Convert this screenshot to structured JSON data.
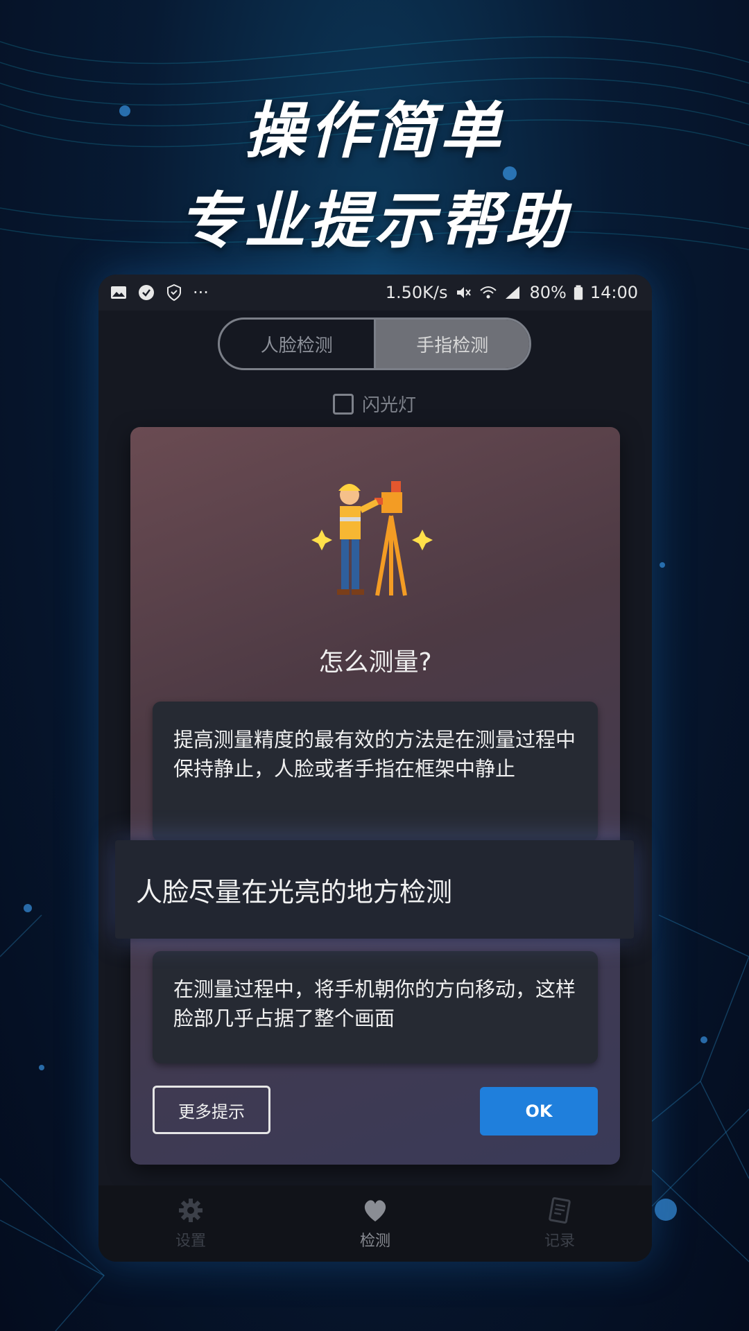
{
  "headline": {
    "line1": "操作简单",
    "line2": "专业提示帮助"
  },
  "statusbar": {
    "speed": "1.50K/s",
    "battery": "80%",
    "time": "14:00",
    "more": "···"
  },
  "tabs": [
    {
      "label": "人脸检测",
      "active": false
    },
    {
      "label": "手指检测",
      "active": true
    }
  ],
  "flash": {
    "label": "闪光灯",
    "checked": false
  },
  "dialog": {
    "title": "怎么测量?",
    "tips": [
      "提高测量精度的最有效的方法是在测量过程中保持静止，人脸或者手指在框架中静止",
      "人脸尽量在光亮的地方检测",
      "在测量过程中，将手机朝你的方向移动，这样脸部几乎占据了整个画面"
    ],
    "more_label": "更多提示",
    "ok_label": "OK"
  },
  "bottom_nav": [
    {
      "label": "设置",
      "icon": "gear-icon",
      "active": false
    },
    {
      "label": "检测",
      "icon": "heart-icon",
      "active": true
    },
    {
      "label": "记录",
      "icon": "record-icon",
      "active": false
    }
  ],
  "colors": {
    "accent": "#1f7fdc",
    "background": "#071a33"
  }
}
